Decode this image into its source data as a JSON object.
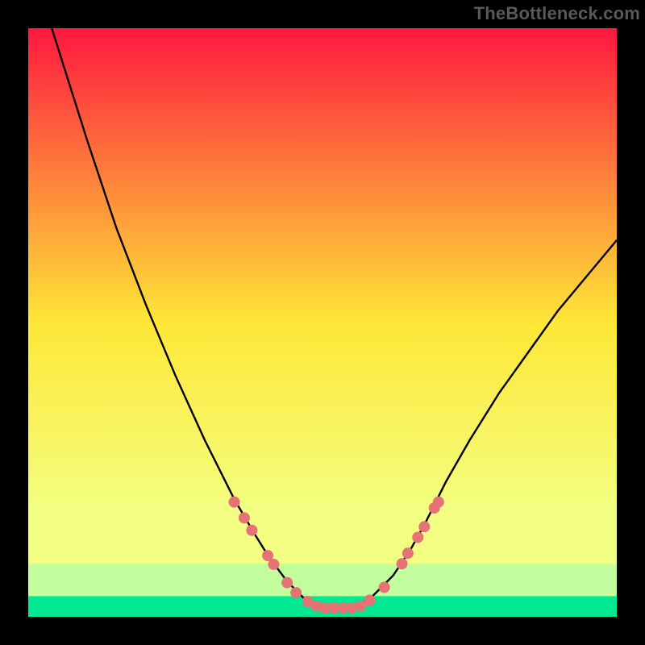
{
  "watermark": {
    "text": "TheBottleneck.com"
  },
  "chart_data": {
    "type": "line",
    "title": "",
    "xlabel": "",
    "ylabel": "",
    "xlim": [
      0,
      100
    ],
    "ylim": [
      0,
      100
    ],
    "grid": false,
    "legend": false,
    "background_gradient": {
      "stops": [
        {
          "offset": 0,
          "color": "#ff183f"
        },
        {
          "offset": 50,
          "color": "#fee737"
        },
        {
          "offset": 83,
          "color": "#f3ff82"
        },
        {
          "offset": 92,
          "color": "#c3fe9e"
        },
        {
          "offset": 100,
          "color": "#00e892"
        }
      ]
    },
    "bands": [
      {
        "name": "pale-yellow",
        "y_from": 80.5,
        "y_to": 91,
        "color": "#f3ff82"
      },
      {
        "name": "pale-green",
        "y_from": 91,
        "y_to": 96.5,
        "color": "#c3fe9e"
      },
      {
        "name": "green",
        "y_from": 96.5,
        "y_to": 100,
        "color": "#00e892"
      }
    ],
    "series": [
      {
        "name": "curve",
        "type": "line",
        "color": "#000000",
        "thickness": 2.4,
        "x": [
          4,
          10,
          15,
          20,
          25,
          30,
          35,
          38.5,
          41,
          44,
          47,
          50,
          53,
          55,
          58,
          62,
          65,
          67.5,
          71,
          75,
          80,
          85,
          90,
          95,
          100
        ],
        "y": [
          0,
          19,
          34,
          47,
          59,
          70,
          80,
          86,
          90,
          94,
          97,
          98.5,
          98.5,
          98.5,
          97,
          93,
          88.5,
          84,
          77,
          70,
          62,
          55,
          48,
          42,
          36
        ]
      },
      {
        "name": "marker-dots",
        "type": "scatter",
        "color": "#e57373",
        "radius": 7,
        "points": [
          {
            "x": 35.0,
            "y": 80.5
          },
          {
            "x": 36.7,
            "y": 83.2
          },
          {
            "x": 38.0,
            "y": 85.3
          },
          {
            "x": 40.7,
            "y": 89.6
          },
          {
            "x": 41.7,
            "y": 91.1
          },
          {
            "x": 44.0,
            "y": 94.2
          },
          {
            "x": 45.5,
            "y": 95.9
          },
          {
            "x": 47.5,
            "y": 97.4
          },
          {
            "x": 49.0,
            "y": 98.2
          },
          {
            "x": 50.5,
            "y": 98.5
          },
          {
            "x": 52.0,
            "y": 98.5
          },
          {
            "x": 53.5,
            "y": 98.5
          },
          {
            "x": 55.0,
            "y": 98.5
          },
          {
            "x": 56.5,
            "y": 98.2
          },
          {
            "x": 58.0,
            "y": 97.2
          },
          {
            "x": 60.5,
            "y": 95.0
          },
          {
            "x": 63.5,
            "y": 91.0
          },
          {
            "x": 64.5,
            "y": 89.2
          },
          {
            "x": 66.2,
            "y": 86.5
          },
          {
            "x": 67.3,
            "y": 84.7
          },
          {
            "x": 69.0,
            "y": 81.5
          },
          {
            "x": 69.7,
            "y": 80.5
          }
        ]
      }
    ]
  }
}
